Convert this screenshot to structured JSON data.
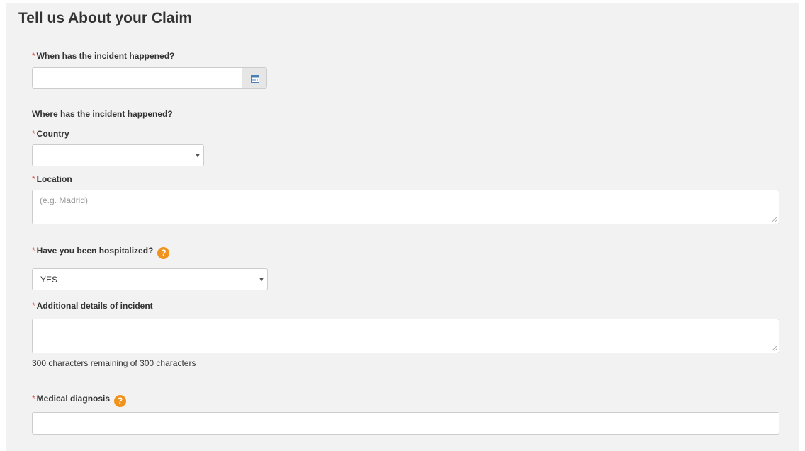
{
  "form": {
    "title": "Tell us About your Claim",
    "required_marker": "*",
    "incident_date": {
      "label": "When has the incident happened?",
      "value": "",
      "calendar_icon": "calendar-icon"
    },
    "where_heading": "Where has the incident happened?",
    "country": {
      "label": "Country",
      "selected": ""
    },
    "location": {
      "label": "Location",
      "placeholder": "(e.g. Madrid)"
    },
    "hospitalized": {
      "label": "Have you been hospitalized?",
      "help_icon": "help-icon",
      "help_glyph": "?",
      "selected": "YES"
    },
    "additional_details": {
      "label": "Additional details of incident",
      "value": "",
      "counter": "300 characters remaining of 300 characters"
    },
    "medical_diagnosis": {
      "label": "Medical diagnosis",
      "help_icon": "help-icon",
      "help_glyph": "?",
      "value": ""
    }
  },
  "colors": {
    "panel_bg": "#f2f2f2",
    "required": "#d9534f",
    "help_badge": "#f0931e",
    "calendar_icon": "#4a7fb5"
  }
}
